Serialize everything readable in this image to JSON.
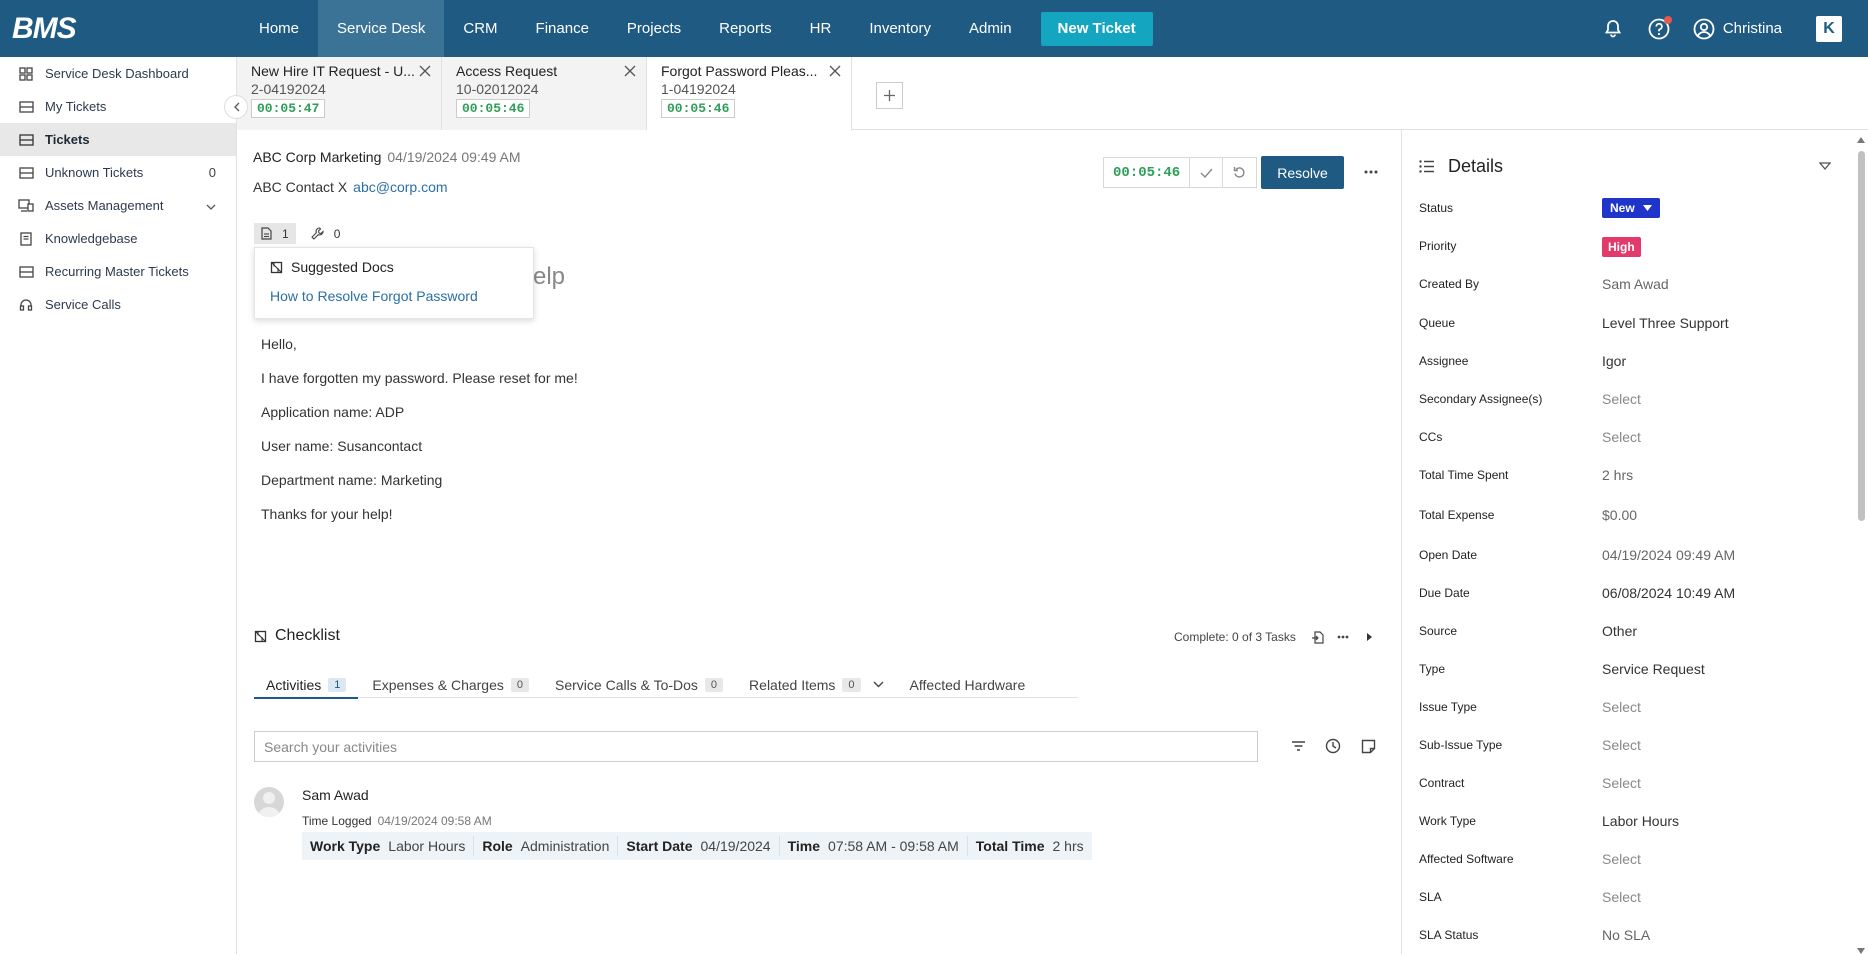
{
  "app": {
    "logo": "BMS"
  },
  "nav": {
    "items": [
      "Home",
      "Service Desk",
      "CRM",
      "Finance",
      "Projects",
      "Reports",
      "HR",
      "Inventory",
      "Admin"
    ],
    "new_ticket": "New Ticket",
    "user_name": "Christina",
    "kaseya_glyph": "K"
  },
  "sidebar": {
    "items": [
      {
        "label": "Service Desk Dashboard",
        "icon": "grid-icon"
      },
      {
        "label": "My Tickets",
        "icon": "ticket-icon"
      },
      {
        "label": "Tickets",
        "icon": "ticket-icon"
      },
      {
        "label": "Unknown Tickets",
        "icon": "ticket-icon",
        "count": "0"
      },
      {
        "label": "Assets Management",
        "icon": "devices-icon"
      },
      {
        "label": "Knowledgebase",
        "icon": "book-icon"
      },
      {
        "label": "Recurring Master Tickets",
        "icon": "ticket-icon"
      },
      {
        "label": "Service Calls",
        "icon": "headset-icon"
      }
    ]
  },
  "tabs": [
    {
      "title": "New Hire IT Request - U...",
      "number": "2-04192024",
      "timer": "00:05:47"
    },
    {
      "title": "Access Request",
      "number": "10-02012024",
      "timer": "00:05:46"
    },
    {
      "title": "Forgot Password Pleas...",
      "number": "1-04192024",
      "timer": "00:05:46"
    }
  ],
  "ticket": {
    "company": "ABC Corp Marketing",
    "date": "04/19/2024 09:49 AM",
    "contact": "ABC Contact X",
    "email": "abc@corp.com",
    "timer": "00:05:46",
    "resolve_label": "Resolve",
    "doc_count": "1",
    "key_count": "0",
    "subject_fragment": "elp",
    "suggested_title": "Suggested Docs",
    "suggested_link": "How to Resolve Forgot Password",
    "body_lines": [
      "Hello,",
      "I have forgotten my password. Please reset for me!",
      "Application name: ADP",
      "User name: Susancontact",
      "Department name: Marketing",
      "Thanks for your help!"
    ]
  },
  "checklist": {
    "title": "Checklist",
    "complete": "Complete: 0 of 3 Tasks"
  },
  "activity_tabs": [
    {
      "label": "Activities",
      "count": "1"
    },
    {
      "label": "Expenses & Charges",
      "count": "0"
    },
    {
      "label": "Service Calls & To-Dos",
      "count": "0"
    },
    {
      "label": "Related Items",
      "count": "0"
    },
    {
      "label": "Affected Hardware"
    }
  ],
  "activities": {
    "search_placeholder": "Search your activities",
    "entry": {
      "name": "Sam Awad",
      "type": "Time Logged",
      "timestamp": "04/19/2024 09:58 AM",
      "fields": [
        {
          "k": "Work Type",
          "v": "Labor Hours"
        },
        {
          "k": "Role",
          "v": "Administration"
        },
        {
          "k": "Start Date",
          "v": "04/19/2024"
        },
        {
          "k": "Time",
          "v": "07:58 AM - 09:58 AM"
        },
        {
          "k": "Total Time",
          "v": "2 hrs"
        }
      ]
    }
  },
  "details": {
    "title": "Details",
    "rows": [
      {
        "k": "Status",
        "v": "New"
      },
      {
        "k": "Priority",
        "v": "High"
      },
      {
        "k": "Created By",
        "v": "Sam Awad"
      },
      {
        "k": "Queue",
        "v": "Level Three Support"
      },
      {
        "k": "Assignee",
        "v": "Igor"
      },
      {
        "k": "Secondary Assignee(s)",
        "v": "Select"
      },
      {
        "k": "CCs",
        "v": "Select"
      },
      {
        "k": "Total Time Spent",
        "v": "2 hrs"
      },
      {
        "k": "Total Expense",
        "v": "$0.00"
      },
      {
        "k": "Open Date",
        "v": "04/19/2024 09:49 AM"
      },
      {
        "k": "Due Date",
        "v": "06/08/2024 10:49 AM"
      },
      {
        "k": "Source",
        "v": "Other"
      },
      {
        "k": "Type",
        "v": "Service Request"
      },
      {
        "k": "Issue Type",
        "v": "Select"
      },
      {
        "k": "Sub-Issue Type",
        "v": "Select"
      },
      {
        "k": "Contract",
        "v": "Select"
      },
      {
        "k": "Work Type",
        "v": "Labor Hours"
      },
      {
        "k": "Affected Software",
        "v": "Select"
      },
      {
        "k": "SLA",
        "v": "Select"
      },
      {
        "k": "SLA Status",
        "v": "No SLA"
      }
    ]
  },
  "colors": {
    "nav_bg": "#1e5a82",
    "accent_teal": "#14a6c0",
    "status_new": "#1f35c9",
    "priority_high": "#e23a6a",
    "timer_green": "#2e9e58"
  }
}
